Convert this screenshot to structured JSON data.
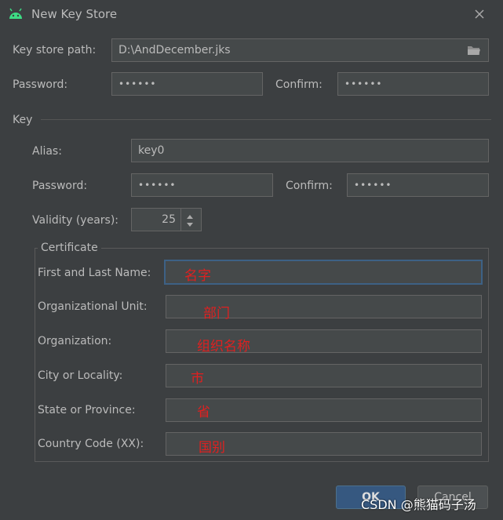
{
  "window": {
    "title": "New Key Store"
  },
  "keystore": {
    "path_label": "Key store path:",
    "path_value": "D:\\AndDecember.jks",
    "password_label": "Password:",
    "password_value": "••••••",
    "confirm_label": "Confirm:",
    "confirm_value": "••••••"
  },
  "key": {
    "section_label": "Key",
    "alias_label": "Alias:",
    "alias_value": "key0",
    "password_label": "Password:",
    "password_value": "••••••",
    "confirm_label": "Confirm:",
    "confirm_value": "••••••",
    "validity_label": "Validity (years):",
    "validity_value": "25"
  },
  "certificate": {
    "section_label": "Certificate",
    "fields": [
      {
        "label": "First and Last Name:",
        "annotation": "名字"
      },
      {
        "label": "Organizational Unit:",
        "annotation": "部门"
      },
      {
        "label": "Organization:",
        "annotation": "组织名称"
      },
      {
        "label": "City or Locality:",
        "annotation": "市"
      },
      {
        "label": "State or Province:",
        "annotation": "省"
      },
      {
        "label": "Country Code (XX):",
        "annotation": "国别"
      }
    ]
  },
  "buttons": {
    "ok": "OK",
    "cancel": "Cancel"
  },
  "watermark": "CSDN @熊猫码子汤",
  "colors": {
    "accent": "#3d6185",
    "annotation": "#e02020",
    "android": "#3ddc84"
  }
}
